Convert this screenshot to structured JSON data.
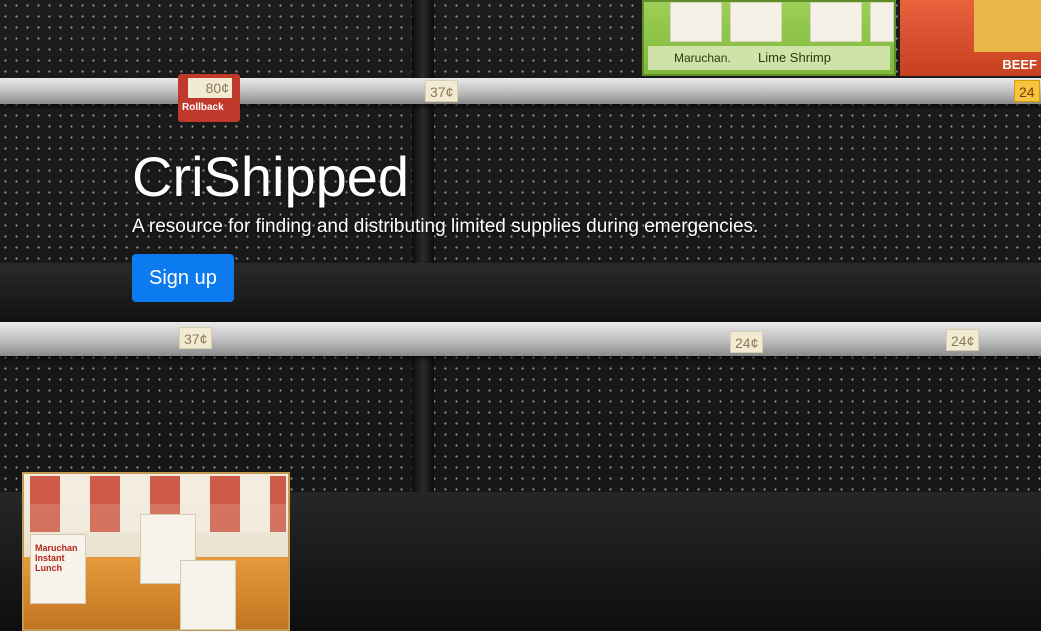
{
  "hero": {
    "title": "CriShipped",
    "subtitle": "A resource for finding and distributing limited supplies during emergencies.",
    "signup_label": "Sign up",
    "button_color": "#0d7bf0"
  },
  "background": {
    "price_tags": [
      "37¢",
      "24",
      "37¢",
      "24¢",
      "24¢"
    ],
    "rollback_price": "80¢",
    "rollback_label": "Rollback",
    "products": {
      "top_box_brand": "Maruchan.",
      "top_box_flavor": "Lime Shrimp",
      "red_box_label": "BEEF",
      "crate_brand": "Maruchan Instant Lunch"
    }
  }
}
